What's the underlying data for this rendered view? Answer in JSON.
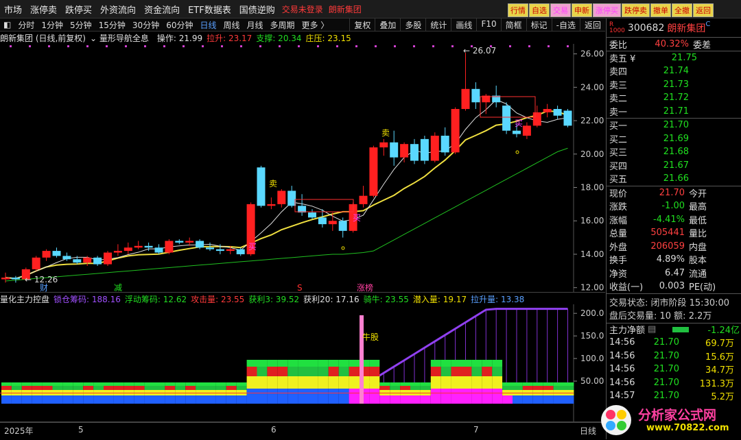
{
  "menu": {
    "items": [
      "市场",
      "涨停卖",
      "跌停买",
      "外资流向",
      "资金流向",
      "ETF数据表",
      "国债逆购"
    ],
    "alert": "交易未登录",
    "alert2": "朗新集团"
  },
  "topbuttons": [
    "行情",
    "自选",
    "交易",
    "申新",
    "涨停买",
    "跌停卖",
    "撤单",
    "全撤",
    "返回"
  ],
  "toolbar": {
    "periods": [
      "分时",
      "1分钟",
      "5分钟",
      "15分钟",
      "30分钟",
      "60分钟",
      "日线",
      "周线",
      "月线",
      "多周期",
      "更多 〉"
    ],
    "active": "日线",
    "right": [
      "复权",
      "叠加",
      "多股",
      "统计",
      "画线",
      "F10",
      "简框",
      "标记",
      "-自选",
      "返回"
    ]
  },
  "main_header": {
    "title": "朗新集团 (日线,前复权)",
    "indicator": "量形导航全息",
    "op": "操作: 21.99",
    "lashen": "拉升: 23.17",
    "zhicheng": "支撑: 20.34",
    "zhuangya": "庄压: 23.15"
  },
  "main_axis": {
    "labels": [
      "26.00",
      "24.00",
      "22.00",
      "20.00",
      "18.00",
      "16.00",
      "14.00",
      "12.00"
    ],
    "high": "26.07",
    "low": "12.26"
  },
  "chart_data": {
    "type": "candlestick",
    "title": "朗新集团 (日线,前复权)",
    "ylim": [
      11.7,
      26.6
    ],
    "candles": [
      [
        12.5,
        12.9,
        12.3,
        12.6
      ],
      [
        12.6,
        12.7,
        12.3,
        12.5
      ],
      [
        12.5,
        13.2,
        12.4,
        13.1
      ],
      [
        13.1,
        13.9,
        13.0,
        13.8
      ],
      [
        13.8,
        14.3,
        13.6,
        14.2
      ],
      [
        14.2,
        14.4,
        13.8,
        13.9
      ],
      [
        13.9,
        14.1,
        13.6,
        13.7
      ],
      [
        13.7,
        13.9,
        13.4,
        13.5
      ],
      [
        13.5,
        13.9,
        13.3,
        13.8
      ],
      [
        13.8,
        13.9,
        13.3,
        13.4
      ],
      [
        13.4,
        14.2,
        13.3,
        14.1
      ],
      [
        14.1,
        14.6,
        13.9,
        14.2
      ],
      [
        14.2,
        14.7,
        14.0,
        14.4
      ],
      [
        14.4,
        14.8,
        14.3,
        14.5
      ],
      [
        14.5,
        14.7,
        14.2,
        14.4
      ],
      [
        14.4,
        14.6,
        14.0,
        14.1
      ],
      [
        14.1,
        14.9,
        14.0,
        14.8
      ],
      [
        14.8,
        14.9,
        14.6,
        14.7
      ],
      [
        14.7,
        15.0,
        14.5,
        14.8
      ],
      [
        14.8,
        14.9,
        14.3,
        14.4
      ],
      [
        14.4,
        14.7,
        14.2,
        14.3
      ],
      [
        14.3,
        14.6,
        14.0,
        14.2
      ],
      [
        14.2,
        14.5,
        14.0,
        14.3
      ],
      [
        14.3,
        14.4,
        13.9,
        14.0
      ],
      [
        14.0,
        17.1,
        13.9,
        17.0
      ],
      [
        19.2,
        19.3,
        16.8,
        16.9
      ],
      [
        16.9,
        17.4,
        16.7,
        17.0
      ],
      [
        17.0,
        17.9,
        16.8,
        17.8
      ],
      [
        17.8,
        18.1,
        16.8,
        16.9
      ],
      [
        16.9,
        17.6,
        16.3,
        16.5
      ],
      [
        16.5,
        16.7,
        16.1,
        16.2
      ],
      [
        16.2,
        16.7,
        15.6,
        15.8
      ],
      [
        15.8,
        16.5,
        15.4,
        16.0
      ],
      [
        16.0,
        16.2,
        15.0,
        15.4
      ],
      [
        15.4,
        17.1,
        15.3,
        17.0
      ],
      [
        17.0,
        18.1,
        16.8,
        17.5
      ],
      [
        17.5,
        20.5,
        17.4,
        20.4
      ],
      [
        20.4,
        20.9,
        19.9,
        20.7
      ],
      [
        20.7,
        21.4,
        19.3,
        19.8
      ],
      [
        19.8,
        20.7,
        19.5,
        20.6
      ],
      [
        20.6,
        20.9,
        19.4,
        19.6
      ],
      [
        20.9,
        21.1,
        19.4,
        19.6
      ],
      [
        19.6,
        21.3,
        19.5,
        21.1
      ],
      [
        21.1,
        21.6,
        19.9,
        20.1
      ],
      [
        20.1,
        22.8,
        20.0,
        22.7
      ],
      [
        22.7,
        26.07,
        22.6,
        23.9
      ],
      [
        23.9,
        24.3,
        22.7,
        23.1
      ],
      [
        23.1,
        23.6,
        22.4,
        23.5
      ],
      [
        23.5,
        24.1,
        22.8,
        23.1
      ],
      [
        22.9,
        23.1,
        21.2,
        21.4
      ],
      [
        21.4,
        21.8,
        21.0,
        21.2
      ],
      [
        21.1,
        21.9,
        20.9,
        21.7
      ],
      [
        21.7,
        22.9,
        21.6,
        22.5
      ],
      [
        22.5,
        23.0,
        22.2,
        22.7
      ],
      [
        22.7,
        22.9,
        22.1,
        22.3
      ],
      [
        22.6,
        22.7,
        21.6,
        21.7
      ]
    ]
  },
  "sub_header": {
    "name": "量化主力控盘",
    "choucang": "锁仓筹码: 188.16",
    "fudong": "浮动筹码: 12.62",
    "gongji": "攻击量: 23.55",
    "huoli3": "获利3: 39.52",
    "huoli20": "获利20: 17.16",
    "qiniu": "骑牛: 23.55",
    "qianru": "潜入量: 19.17",
    "lasheng": "拉升量: 13.38"
  },
  "sub_axis": [
    "200.0",
    "150.0",
    "100.0",
    "50.00"
  ],
  "x_axis": {
    "year": "2025年",
    "months": [
      "5",
      "6",
      "7"
    ],
    "period": "日线"
  },
  "markers": {
    "cai": "财",
    "jian": "减",
    "s": "S",
    "zhangbang": "涨榜",
    "niugu": "牛股",
    "mai": "卖",
    "mai2": "买"
  },
  "quote": {
    "code": "300682",
    "name": "朗新集团",
    "weibi_label": "委比",
    "weibi": "40.32%",
    "weicha_label": "委差",
    "sell": [
      [
        "卖五 ¥",
        "21.75"
      ],
      [
        "卖四",
        "21.74"
      ],
      [
        "卖三",
        "21.73"
      ],
      [
        "卖二",
        "21.72"
      ],
      [
        "卖一",
        "21.71"
      ]
    ],
    "buy": [
      [
        "买一",
        "21.70"
      ],
      [
        "买二",
        "21.69"
      ],
      [
        "买三",
        "21.68"
      ],
      [
        "买四",
        "21.67"
      ],
      [
        "买五",
        "21.66"
      ]
    ],
    "stats": [
      [
        "现价",
        "21.70",
        "今开"
      ],
      [
        "涨跌",
        "-1.00",
        "最高"
      ],
      [
        "涨幅",
        "-4.41%",
        "最低"
      ],
      [
        "总量",
        "505441",
        "量比"
      ],
      [
        "外盘",
        "206059",
        "内盘"
      ],
      [
        "换手",
        "4.89%",
        "股本"
      ],
      [
        "净资",
        "6.47",
        "流通"
      ],
      [
        "收益(一)",
        "0.003",
        "PE(动)"
      ]
    ],
    "status": "交易状态: 闭市阶段 15:30:00",
    "after": "盘后交易量: 10  额: 2.2万",
    "net_label": "主力净额",
    "net_value": "-1.24亿",
    "ticks": [
      [
        "14:56",
        "21.70",
        "69.7万"
      ],
      [
        "14:56",
        "21.70",
        "15.6万"
      ],
      [
        "14:56",
        "21.70",
        "34.7万"
      ],
      [
        "14:56",
        "21.70",
        "131.3万"
      ],
      [
        "14:57",
        "21.70",
        "5.2万"
      ]
    ]
  },
  "watermark": {
    "text": "分析家公式网",
    "url": "www.70822.com"
  },
  "colors": {
    "up": "#ff2020",
    "down": "#5ad8ff",
    "ma_yellow": "#f0e040",
    "ma_white": "#e0e0e0",
    "support": "#20c020",
    "accent": "#5aa0ff"
  }
}
